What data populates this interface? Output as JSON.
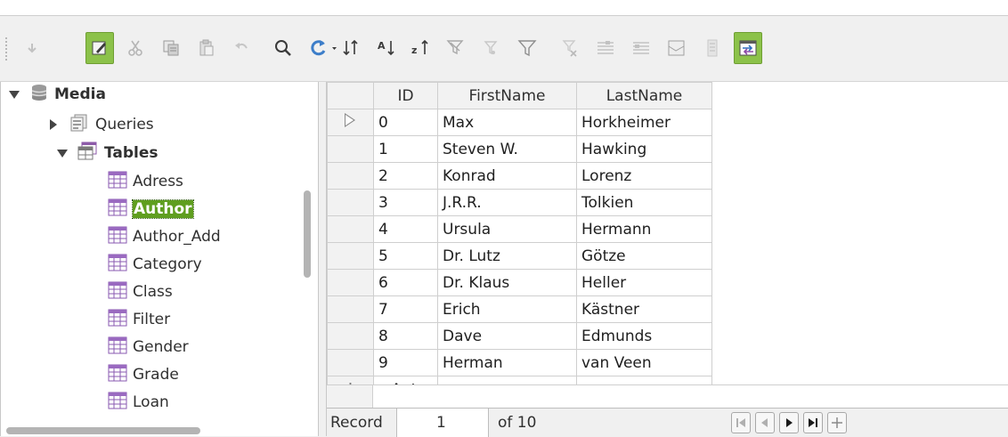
{
  "toolbar": {
    "buttons": [
      {
        "name": "save-record-icon"
      },
      {
        "name": "edit-data-icon",
        "active": true
      },
      {
        "name": "cut-icon"
      },
      {
        "name": "copy-icon"
      },
      {
        "name": "paste-icon"
      },
      {
        "name": "undo-icon"
      },
      {
        "name": "find-record-icon"
      },
      {
        "name": "refresh-icon"
      },
      {
        "name": "sort-icon"
      },
      {
        "name": "sort-ascending-icon"
      },
      {
        "name": "sort-descending-icon"
      },
      {
        "name": "autofilter-icon"
      },
      {
        "name": "apply-filter-icon"
      },
      {
        "name": "standard-filter-icon"
      },
      {
        "name": "reset-filter-icon"
      },
      {
        "name": "data-to-text-icon"
      },
      {
        "name": "data-to-fields-icon"
      },
      {
        "name": "mail-merge-icon"
      },
      {
        "name": "data-source-icon"
      },
      {
        "name": "explorer-toggle-icon",
        "active": true
      }
    ]
  },
  "tree": {
    "root": "Media",
    "queries": "Queries",
    "tables": "Tables",
    "items": [
      "Adress",
      "Author",
      "Author_Add",
      "Category",
      "Class",
      "Filter",
      "Gender",
      "Grade",
      "Loan"
    ],
    "selected": "Author"
  },
  "grid": {
    "columns": [
      "ID",
      "FirstName",
      "LastName"
    ],
    "rows": [
      {
        "id": "0",
        "first": "Max",
        "last": "Horkheimer"
      },
      {
        "id": "1",
        "first": "Steven W.",
        "last": "Hawking"
      },
      {
        "id": "2",
        "first": "Konrad",
        "last": "Lorenz"
      },
      {
        "id": "3",
        "first": "J.R.R.",
        "last": "Tolkien"
      },
      {
        "id": "4",
        "first": "Ursula",
        "last": "Hermann"
      },
      {
        "id": "5",
        "first": "Dr. Lutz",
        "last": "Götze"
      },
      {
        "id": "6",
        "first": "Dr. Klaus",
        "last": "Heller"
      },
      {
        "id": "7",
        "first": "Erich",
        "last": "Kästner"
      },
      {
        "id": "8",
        "first": "Dave",
        "last": "Edmunds"
      },
      {
        "id": "9",
        "first": "Herman",
        "last": "van Veen"
      }
    ],
    "new_row_id": "<Auto"
  },
  "navigator": {
    "label": "Record",
    "current": "1",
    "total_text": "of 10"
  }
}
